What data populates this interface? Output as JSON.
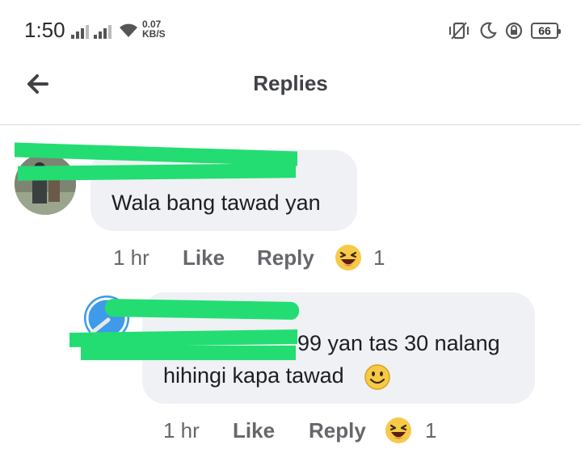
{
  "status_bar": {
    "time": "1:50",
    "net_speed_value": "0.07",
    "net_speed_unit": "KB/S",
    "battery": "66"
  },
  "header": {
    "title": "Replies",
    "back_icon": "arrow-left-icon"
  },
  "comments": [
    {
      "author": "",
      "text": "Wala bang tawad yan",
      "time": "1 hr",
      "like_label": "Like",
      "reply_label": "Reply",
      "reaction_icon": "laughing-emoji-icon",
      "reaction_count": "1"
    },
    {
      "author": "",
      "text_line1": "99 yan tas 30 nalang",
      "text_line2": "hihingi kapa tawad",
      "inline_emoji": "smiley-emoji-icon",
      "time": "1 hr",
      "like_label": "Like",
      "reply_label": "Reply",
      "reaction_icon": "laughing-emoji-icon",
      "reaction_count": "1"
    }
  ],
  "colors": {
    "bubble": "#eff1f4",
    "meta_text": "#65676b",
    "redaction": "#23dd72",
    "emoji_yellow": "#f7c948"
  }
}
